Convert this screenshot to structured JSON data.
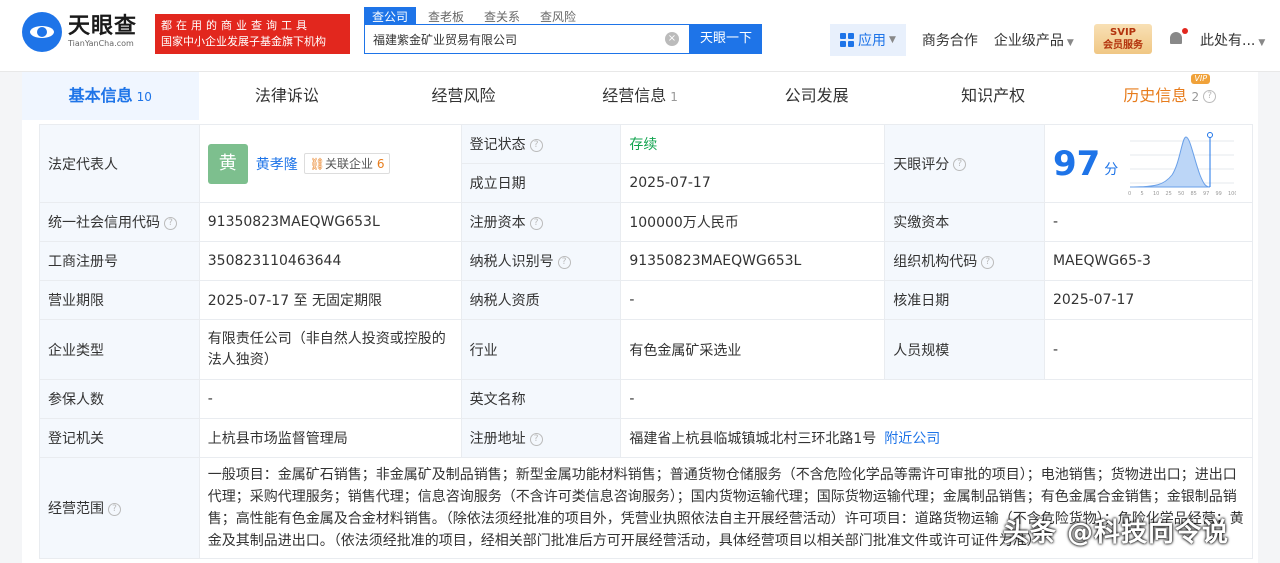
{
  "header": {
    "logo_cn": "天眼查",
    "logo_en": "TianYanCha.com",
    "slogan_line1": "都在用的商业查询工具",
    "slogan_line2": "国家中小企业发展子基金旗下机构",
    "search_tabs": [
      "查公司",
      "查老板",
      "查关系",
      "查风险"
    ],
    "search_value": "福建紫金矿业贸易有限公司",
    "search_button": "天眼一下",
    "nav": {
      "apps": "应用",
      "business": "商务合作",
      "enterprise": "企业级产品",
      "svip_line1": "SVIP",
      "svip_line2": "会员服务",
      "user": "此处有..."
    }
  },
  "tabs": [
    {
      "label": "基本信息",
      "count": "10"
    },
    {
      "label": "法律诉讼",
      "count": ""
    },
    {
      "label": "经营风险",
      "count": ""
    },
    {
      "label": "经营信息",
      "count": "1"
    },
    {
      "label": "公司发展",
      "count": ""
    },
    {
      "label": "知识产权",
      "count": ""
    },
    {
      "label": "历史信息",
      "count": "2",
      "tag": "VIP"
    }
  ],
  "info": {
    "legal_rep_label": "法定代表人",
    "legal_rep_avatar": "黄",
    "legal_rep_name": "黄孝隆",
    "related_label": "关联企业",
    "related_count": "6",
    "reg_status_label": "登记状态",
    "reg_status": "存续",
    "founded_label": "成立日期",
    "founded": "2025-07-17",
    "score_label": "天眼评分",
    "score": "97",
    "score_unit": "分",
    "credit_code_label": "统一社会信用代码",
    "credit_code": "91350823MAEQWG653L",
    "capital_label": "注册资本",
    "capital": "100000万人民币",
    "paid_label": "实缴资本",
    "paid": "-",
    "biz_reg_label": "工商注册号",
    "biz_reg": "350823110463644",
    "taxpayer_label": "纳税人识别号",
    "taxpayer": "91350823MAEQWG653L",
    "org_code_label": "组织机构代码",
    "org_code": "MAEQWG65-3",
    "term_label": "营业期限",
    "term": "2025-07-17 至 无固定期限",
    "tax_qual_label": "纳税人资质",
    "tax_qual": "-",
    "approve_label": "核准日期",
    "approve": "2025-07-17",
    "type_label": "企业类型",
    "type": "有限责任公司（非自然人投资或控股的法人独资）",
    "industry_label": "行业",
    "industry": "有色金属矿采选业",
    "staff_label": "人员规模",
    "staff": "-",
    "insured_label": "参保人数",
    "insured": "-",
    "en_name_label": "英文名称",
    "en_name": "-",
    "authority_label": "登记机关",
    "authority": "上杭县市场监督管理局",
    "address_label": "注册地址",
    "address": "福建省上杭县临城镇城北村三环北路1号",
    "nearby": "附近公司",
    "scope_label": "经营范围",
    "scope": "一般项目：金属矿石销售；非金属矿及制品销售；新型金属功能材料销售；普通货物仓储服务（不含危险化学品等需许可审批的项目）；电池销售；货物进出口；进出口代理；采购代理服务；销售代理；信息咨询服务（不含许可类信息咨询服务）；国内货物运输代理；国际货物运输代理；金属制品销售；有色金属合金销售；金银制品销售；高性能有色金属及合金材料销售。（除依法须经批准的项目外，凭营业执照依法自主开展经营活动）许可项目：道路货物运输（不含危险货物）；危险化学品经营；黄金及其制品进出口。（依法须经批准的项目，经相关部门批准后方可开展经营活动，具体经营项目以相关部门批准文件或许可证件为准）"
  },
  "score_axis": [
    "0",
    "5",
    "10",
    "25",
    "50",
    "85",
    "97",
    "99",
    "100"
  ],
  "watermark": "头条 @科技向令说"
}
